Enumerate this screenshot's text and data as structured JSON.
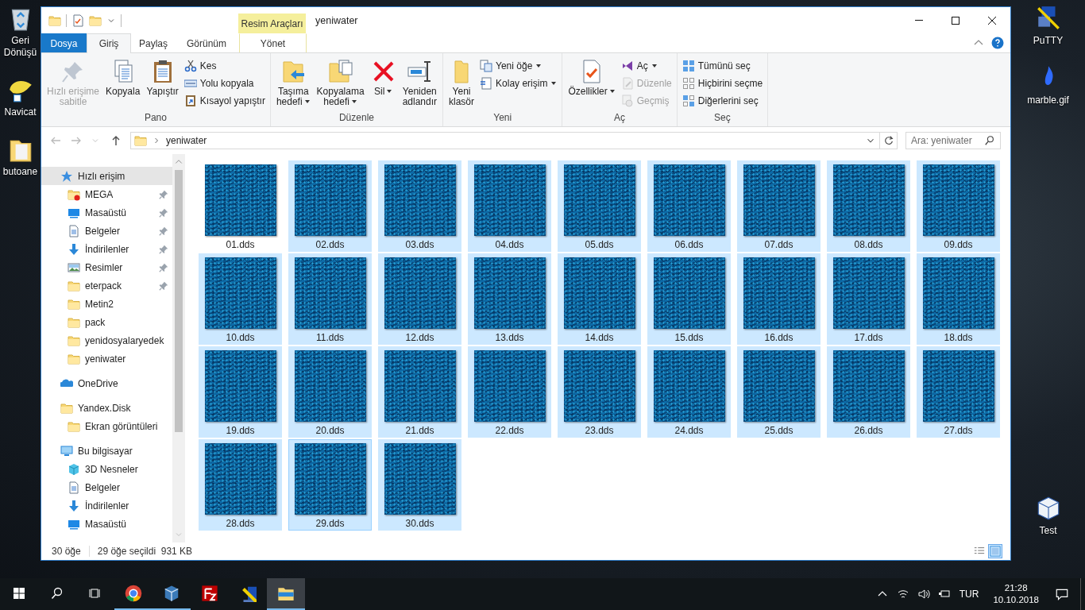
{
  "desktop": {
    "left": [
      {
        "kind": "recycle",
        "label": "Geri Dönüşü"
      },
      {
        "kind": "app",
        "label": "Navicat"
      },
      {
        "kind": "folder",
        "label": "butoane"
      }
    ],
    "right": [
      {
        "kind": "terminal",
        "label": "PuTTY"
      },
      {
        "kind": "image",
        "label": "marble.gif"
      },
      {
        "kind": "box",
        "label": "Test"
      }
    ]
  },
  "window": {
    "title": "yeniwater",
    "context_group": "Resim Araçları"
  },
  "tabs": [
    {
      "label": "Dosya",
      "kind": "file",
      "selected": false
    },
    {
      "label": "Giriş",
      "kind": "tab",
      "selected": true
    },
    {
      "label": "Paylaş",
      "kind": "tab",
      "selected": false
    },
    {
      "label": "Görünüm",
      "kind": "tab",
      "selected": false
    },
    {
      "label": "Yönet",
      "kind": "context",
      "selected": false
    }
  ],
  "ribbon": {
    "groups": [
      {
        "label": "Pano",
        "items": [
          {
            "label": "Hızlı erişime\nsabitle",
            "kind": "large",
            "disabled": true,
            "dropdown": false
          },
          {
            "label": "Kopyala",
            "kind": "large",
            "disabled": false,
            "dropdown": false
          },
          {
            "label": "Yapıştır",
            "kind": "large",
            "disabled": false,
            "dropdown": false
          },
          {
            "label": "Kes",
            "kind": "small",
            "disabled": false,
            "dropdown": false
          },
          {
            "label": "Yolu kopyala",
            "kind": "small",
            "disabled": false,
            "dropdown": false
          },
          {
            "label": "Kısayol yapıştır",
            "kind": "small",
            "disabled": false,
            "dropdown": false
          }
        ]
      },
      {
        "label": "Düzenle",
        "items": [
          {
            "label": "Taşıma\nhedefi",
            "kind": "large",
            "disabled": false,
            "dropdown": true
          },
          {
            "label": "Kopyalama\nhedefi",
            "kind": "large",
            "disabled": false,
            "dropdown": true
          },
          {
            "label": "Sil",
            "kind": "large",
            "disabled": false,
            "dropdown": true
          },
          {
            "label": "Yeniden\nadlandır",
            "kind": "large",
            "disabled": false,
            "dropdown": false
          }
        ]
      },
      {
        "label": "Yeni",
        "items": [
          {
            "label": "Yeni\nklasör",
            "kind": "large",
            "disabled": false,
            "dropdown": false
          },
          {
            "label": "Yeni öğe",
            "kind": "small",
            "disabled": false,
            "dropdown": true
          },
          {
            "label": "Kolay erişim",
            "kind": "small",
            "disabled": false,
            "dropdown": true
          }
        ]
      },
      {
        "label": "Aç",
        "items": [
          {
            "label": "Özellikler",
            "kind": "large",
            "disabled": false,
            "dropdown": true
          },
          {
            "label": "Aç",
            "kind": "small",
            "disabled": false,
            "dropdown": true
          },
          {
            "label": "Düzenle",
            "kind": "small",
            "disabled": true,
            "dropdown": false
          },
          {
            "label": "Geçmiş",
            "kind": "small",
            "disabled": true,
            "dropdown": false
          }
        ]
      },
      {
        "label": "Seç",
        "items": [
          {
            "label": "Tümünü seç",
            "kind": "small",
            "disabled": false,
            "dropdown": false
          },
          {
            "label": "Hiçbirini seçme",
            "kind": "small",
            "disabled": false,
            "dropdown": false
          },
          {
            "label": "Diğerlerini seç",
            "kind": "small",
            "disabled": false,
            "dropdown": false
          }
        ]
      }
    ]
  },
  "address": {
    "path": [
      "yeniwater"
    ],
    "search_placeholder": "Ara: yeniwater"
  },
  "sidebar": {
    "items": [
      {
        "label": "Hızlı erişim",
        "kind": "quick",
        "selected": true,
        "children": [
          {
            "label": "MEGA",
            "kind": "mega",
            "pinned": true
          },
          {
            "label": "Masaüstü",
            "kind": "desktop",
            "pinned": true
          },
          {
            "label": "Belgeler",
            "kind": "documents",
            "pinned": true
          },
          {
            "label": "İndirilenler",
            "kind": "downloads",
            "pinned": true
          },
          {
            "label": "Resimler",
            "kind": "pictures",
            "pinned": true
          },
          {
            "label": "eterpack",
            "kind": "folder",
            "pinned": true
          },
          {
            "label": "Metin2",
            "kind": "folder",
            "pinned": false
          },
          {
            "label": "pack",
            "kind": "folder",
            "pinned": false
          },
          {
            "label": "yenidosyalaryedek",
            "kind": "folder",
            "pinned": false
          },
          {
            "label": "yeniwater",
            "kind": "folder",
            "pinned": false
          }
        ]
      },
      {
        "label": "OneDrive",
        "kind": "onedrive",
        "selected": false
      },
      {
        "label": "Yandex.Disk",
        "kind": "folder",
        "selected": false,
        "children": [
          {
            "label": "Ekran görüntüleri",
            "kind": "folder",
            "pinned": false
          }
        ]
      },
      {
        "label": "Bu bilgisayar",
        "kind": "pc",
        "selected": false,
        "children": [
          {
            "label": "3D Nesneler",
            "kind": "objects3d",
            "pinned": false
          },
          {
            "label": "Belgeler",
            "kind": "documents",
            "pinned": false
          },
          {
            "label": "İndirilenler",
            "kind": "downloads",
            "pinned": false
          },
          {
            "label": "Masaüstü",
            "kind": "desktop",
            "pinned": false
          }
        ]
      }
    ]
  },
  "files": [
    {
      "name": "01.dds",
      "selected": false,
      "focused": false
    },
    {
      "name": "02.dds",
      "selected": true,
      "focused": false
    },
    {
      "name": "03.dds",
      "selected": true,
      "focused": false
    },
    {
      "name": "04.dds",
      "selected": true,
      "focused": false
    },
    {
      "name": "05.dds",
      "selected": true,
      "focused": false
    },
    {
      "name": "06.dds",
      "selected": true,
      "focused": false
    },
    {
      "name": "07.dds",
      "selected": true,
      "focused": false
    },
    {
      "name": "08.dds",
      "selected": true,
      "focused": false
    },
    {
      "name": "09.dds",
      "selected": true,
      "focused": false
    },
    {
      "name": "10.dds",
      "selected": true,
      "focused": false
    },
    {
      "name": "11.dds",
      "selected": true,
      "focused": false
    },
    {
      "name": "12.dds",
      "selected": true,
      "focused": false
    },
    {
      "name": "13.dds",
      "selected": true,
      "focused": false
    },
    {
      "name": "14.dds",
      "selected": true,
      "focused": false
    },
    {
      "name": "15.dds",
      "selected": true,
      "focused": false
    },
    {
      "name": "16.dds",
      "selected": true,
      "focused": false
    },
    {
      "name": "17.dds",
      "selected": true,
      "focused": false
    },
    {
      "name": "18.dds",
      "selected": true,
      "focused": false
    },
    {
      "name": "19.dds",
      "selected": true,
      "focused": false
    },
    {
      "name": "20.dds",
      "selected": true,
      "focused": false
    },
    {
      "name": "21.dds",
      "selected": true,
      "focused": false
    },
    {
      "name": "22.dds",
      "selected": true,
      "focused": false
    },
    {
      "name": "23.dds",
      "selected": true,
      "focused": false
    },
    {
      "name": "24.dds",
      "selected": true,
      "focused": false
    },
    {
      "name": "25.dds",
      "selected": true,
      "focused": false
    },
    {
      "name": "26.dds",
      "selected": true,
      "focused": false
    },
    {
      "name": "27.dds",
      "selected": true,
      "focused": false
    },
    {
      "name": "28.dds",
      "selected": true,
      "focused": false
    },
    {
      "name": "29.dds",
      "selected": true,
      "focused": true
    },
    {
      "name": "30.dds",
      "selected": true,
      "focused": false
    }
  ],
  "status_bar": {
    "count": "30 öğe",
    "selection": "29 öğe seçildi  931 KB",
    "views": [
      {
        "kind": "details",
        "selected": false
      },
      {
        "kind": "large",
        "selected": true
      }
    ]
  },
  "taskbar": {
    "apps": [
      {
        "kind": "browser",
        "running": true,
        "active": false
      },
      {
        "kind": "vm",
        "running": true,
        "active": false
      },
      {
        "kind": "ftp",
        "running": false,
        "active": false
      },
      {
        "kind": "terminal",
        "running": false,
        "active": false
      },
      {
        "kind": "files",
        "running": true,
        "active": true
      }
    ],
    "language": "TUR",
    "time": "21:28",
    "date": "10.10.2018"
  }
}
